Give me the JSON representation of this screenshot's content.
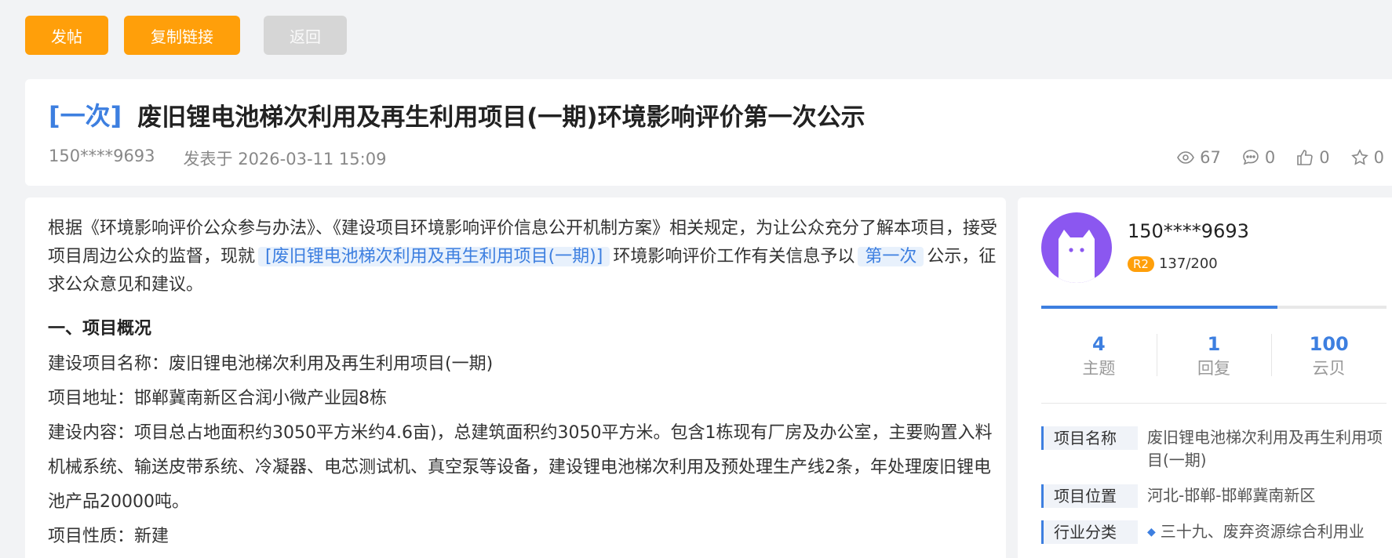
{
  "toolbar": {
    "post_label": "发帖",
    "copy_link_label": "复制链接",
    "back_label": "返回"
  },
  "post": {
    "tag": "[一次]",
    "title": "废旧锂电池梯次利用及再生利用项目(一期)环境影响评价第一次公示",
    "author": "150****9693",
    "posted": "发表于 2026-03-11 15:09",
    "stats": {
      "views": "67",
      "comments": "0",
      "likes": "0",
      "favorites": "0"
    }
  },
  "content": {
    "intro_part1": "根据《环境影响评价公众参与办法》、《建设项目环境影响评价信息公开机制方案》相关规定，为让公众充分了解本项目，接受项目周边公众的监督，现就",
    "intro_project": "[废旧锂电池梯次利用及再生利用项目(一期)]",
    "intro_part2": "环境影响评价工作有关信息予以",
    "intro_stage": "第一次",
    "intro_part3": "公示，征求公众意见和建议。",
    "section1_title": "一、项目概况",
    "lines": [
      "建设项目名称：废旧锂电池梯次利用及再生利用项目(一期)",
      "项目地址：邯郸冀南新区合润小微产业园8栋",
      "建设内容：项目总占地面积约3050平方米约4.6亩)，总建筑面积约3050平方米。包含1栋现有厂房及办公室，主要购置入料机械系统、输送皮带系统、冷凝器、电芯测试机、真空泵等设备，建设锂电池梯次利用及预处理生产线2条，年处理废旧锂电池产品20000吨。",
      "项目性质：新建"
    ]
  },
  "sidebar": {
    "username": "150****9693",
    "level": "R2",
    "level_progress": "137/200",
    "progress_fraction": 0.685,
    "counts": [
      {
        "value": "4",
        "label": "主题"
      },
      {
        "value": "1",
        "label": "回复"
      },
      {
        "value": "100",
        "label": "云贝"
      }
    ],
    "props": [
      {
        "key": "项目名称",
        "value": "废旧锂电池梯次利用及再生利用项目(一期)"
      },
      {
        "key": "项目位置",
        "value": "河北-邯郸-邯郸冀南新区"
      },
      {
        "key": "行业分类",
        "value": "三十九、废弃资源综合利用业"
      }
    ]
  },
  "colors": {
    "accent": "#3d7fe0",
    "primary_button": "#ff9f0a",
    "disabled_button": "#d6d6d6",
    "avatar": "#8b57f0"
  }
}
